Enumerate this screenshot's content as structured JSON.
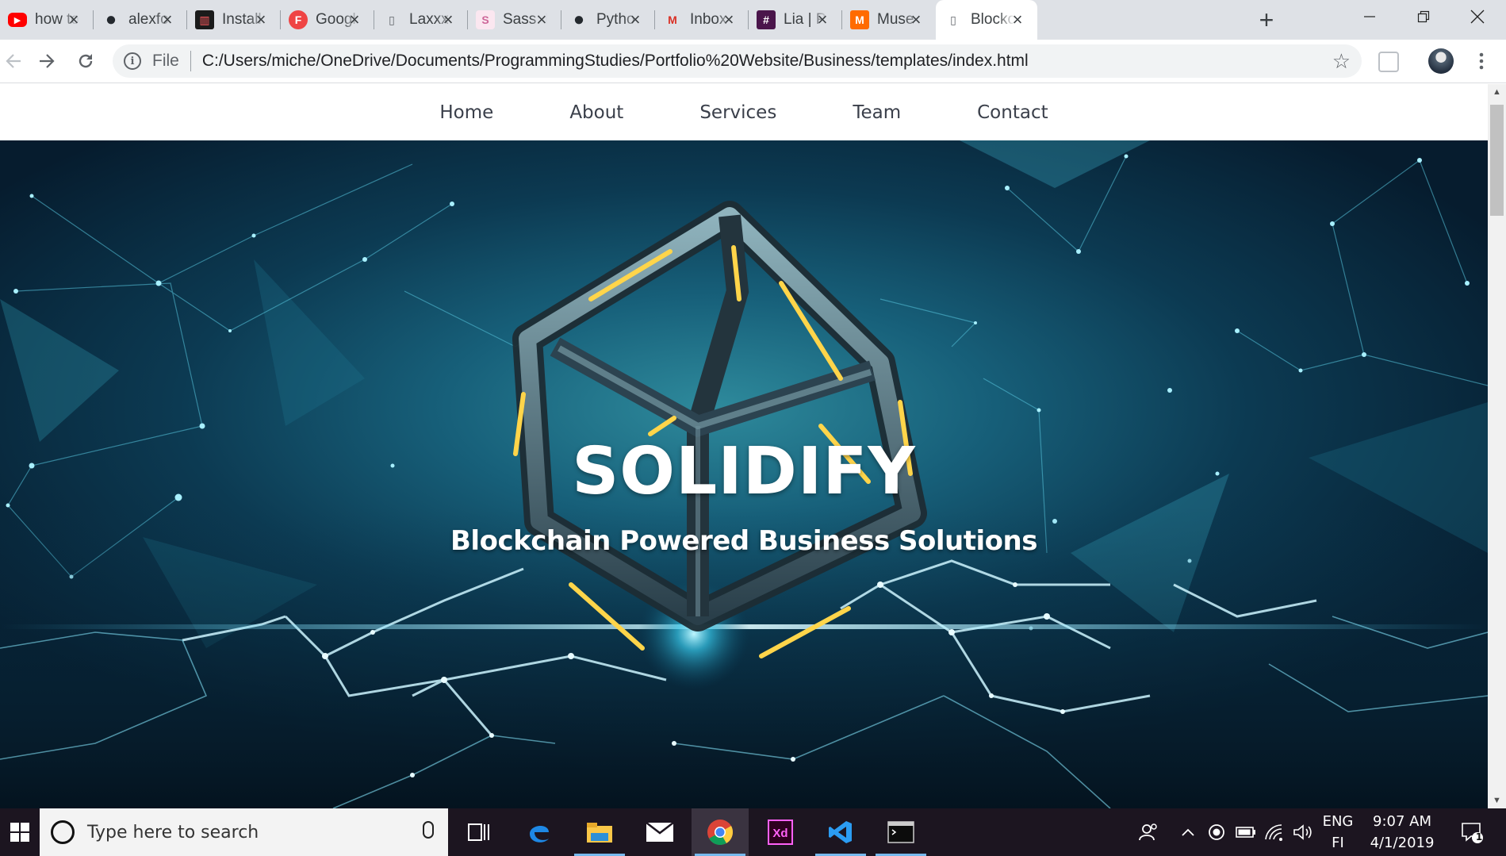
{
  "browser": {
    "tabs": [
      {
        "title": "how to",
        "icon": "youtube-icon",
        "color": "#ff0000"
      },
      {
        "title": "alexfo",
        "icon": "github-icon",
        "color": "#24292e"
      },
      {
        "title": "Install",
        "icon": "app-bars-icon",
        "color": "#2b3990"
      },
      {
        "title": "Googl",
        "icon": "f-logo-icon",
        "color": "#ef4444"
      },
      {
        "title": "Laxxx",
        "icon": "file-icon",
        "color": "#5f6368"
      },
      {
        "title": "Sass: I",
        "icon": "sass-icon",
        "color": "#cd6799"
      },
      {
        "title": "Pytho",
        "icon": "github-icon",
        "color": "#24292e"
      },
      {
        "title": "Inbox",
        "icon": "gmail-icon",
        "color": "#d93025"
      },
      {
        "title": "Lia | P",
        "icon": "slack-icon",
        "color": "#4a154b"
      },
      {
        "title": "Muse",
        "icon": "muse-icon",
        "color": "#ff6b00"
      },
      {
        "title": "Blocko",
        "icon": "file-icon",
        "color": "#5f6368",
        "active": true
      }
    ],
    "new_tab_label": "+",
    "address": {
      "scheme_label": "File",
      "url": "C:/Users/miche/OneDrive/Documents/ProgrammingStudies/Portfolio%20Website/Business/templates/index.html"
    }
  },
  "site": {
    "nav": [
      "Home",
      "About",
      "Services",
      "Team",
      "Contact"
    ],
    "hero": {
      "title": "SOLIDIFY",
      "subtitle": "Blockchain Powered Business Solutions"
    }
  },
  "taskbar": {
    "search_placeholder": "Type here to search",
    "apps": [
      "task-view-icon",
      "edge-icon",
      "file-explorer-icon",
      "mail-icon",
      "chrome-icon",
      "adobe-xd-icon",
      "vscode-icon",
      "terminal-icon"
    ],
    "language_top": "ENG",
    "language_bottom": "FI",
    "time": "9:07 AM",
    "date": "4/1/2019",
    "notification_count": "1"
  }
}
